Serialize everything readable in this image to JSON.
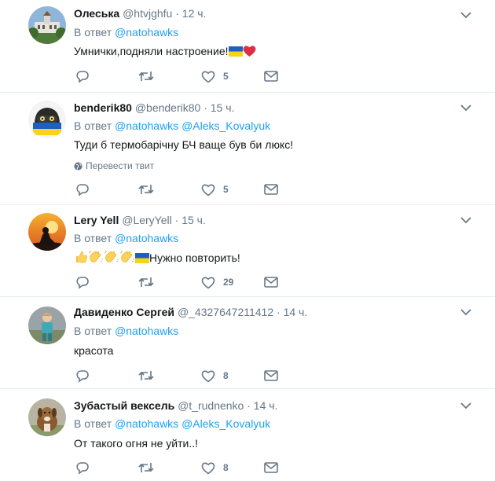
{
  "tweets": [
    {
      "name": "Олеська",
      "handle": "@htvjghfu",
      "time": "· 12 ч.",
      "reply_prefix": "В ответ",
      "mentions": [
        "@natohawks"
      ],
      "text": "Умнички,подняли настроение!",
      "likes": "5",
      "avatar_icon": "palace-photo"
    },
    {
      "name": "benderik80",
      "handle": "@benderik80",
      "time": "· 15 ч.",
      "reply_prefix": "В ответ",
      "mentions": [
        "@natohawks",
        "@Aleks_Kovalyuk"
      ],
      "text": "Туди б термобарічну БЧ ваще був би люкс!",
      "translate": "Перевести твит",
      "likes": "5",
      "avatar_icon": "bender-ukraine-avatar"
    },
    {
      "name": "Lery Yell",
      "handle": "@LeryYell",
      "time": "· 15 ч.",
      "reply_prefix": "В ответ",
      "mentions": [
        "@natohawks"
      ],
      "text": "Нужно повторить!",
      "likes": "29",
      "avatar_icon": "sunset-silhouette-photo"
    },
    {
      "name": "Давиденко Сергей",
      "handle": "@_4327647211412",
      "time": "· 14 ч.",
      "reply_prefix": "В ответ",
      "mentions": [
        "@natohawks"
      ],
      "text": "красота",
      "likes": "8",
      "avatar_icon": "child-photo"
    },
    {
      "name": "Зубастый вексель",
      "handle": "@t_rudnenko",
      "time": "· 14 ч.",
      "reply_prefix": "В ответ",
      "mentions": [
        "@natohawks",
        "@Aleks_Kovalyuk"
      ],
      "text": "От такого огня не уйти..!",
      "likes": "8",
      "avatar_icon": "dog-photo"
    }
  ],
  "colors": {
    "link": "#1da1f2",
    "secondary": "#657786",
    "border": "#e6ecf0",
    "heart": "#e0245e"
  }
}
